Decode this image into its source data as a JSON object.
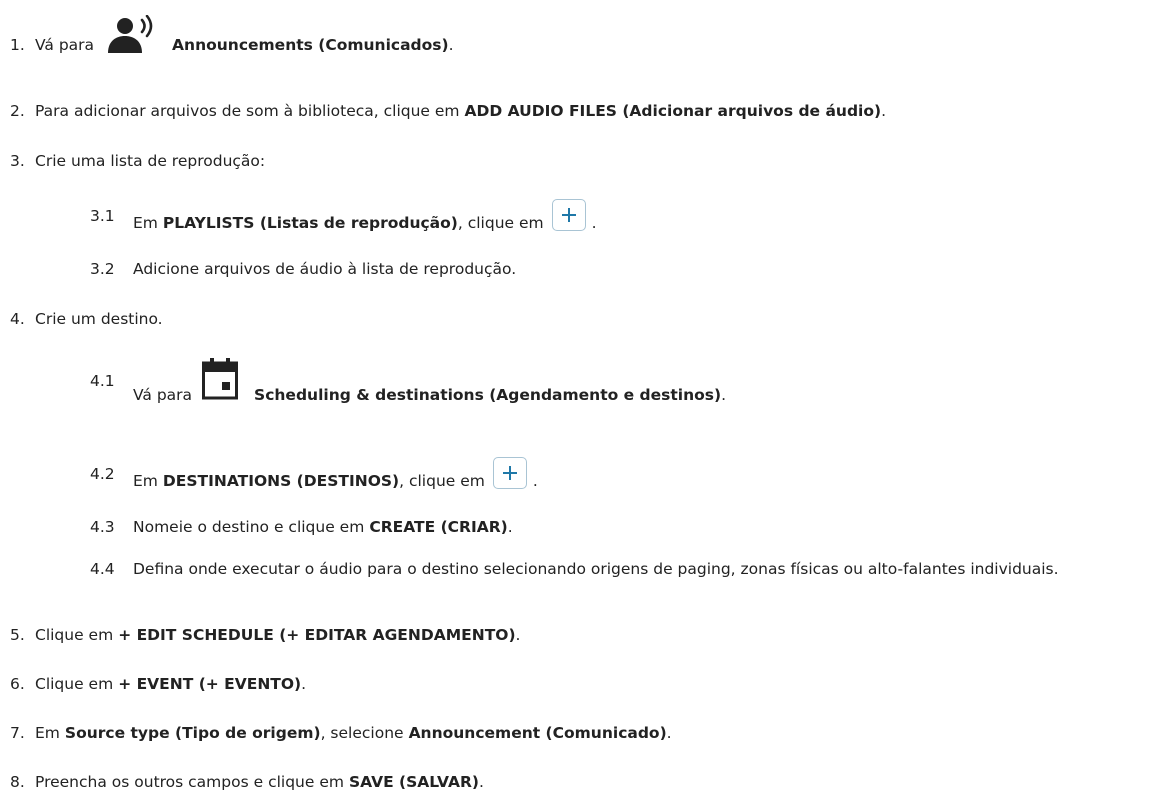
{
  "steps": {
    "s1": {
      "num": "1.",
      "pre": "Vá para",
      "bold": "Announcements (Comunicados)",
      "post": ".",
      "icon": "announcement-speaker-icon"
    },
    "s2": {
      "num": "2.",
      "pre": "Para adicionar arquivos de som à biblioteca, clique em",
      "bold": "ADD AUDIO FILES (Adicionar arquivos de áudio)",
      "post": "."
    },
    "s3": {
      "num": "3.",
      "text": "Crie uma lista de reprodução:"
    },
    "s3_1": {
      "num": "3.1",
      "pre": "Em",
      "bold": "PLAYLISTS (Listas de reprodução)",
      "mid": ", clique em",
      "post": ".",
      "icon": "plus-icon"
    },
    "s3_2": {
      "num": "3.2",
      "text": "Adicione arquivos de áudio à lista de reprodução."
    },
    "s4": {
      "num": "4.",
      "text": "Crie um destino."
    },
    "s4_1": {
      "num": "4.1",
      "pre": "Vá para",
      "bold": "Scheduling & destinations (Agendamento e destinos)",
      "post": ".",
      "icon": "calendar-icon"
    },
    "s4_2": {
      "num": "4.2",
      "pre": "Em",
      "bold": "DESTINATIONS (DESTINOS)",
      "mid": ", clique em",
      "post": ".",
      "icon": "plus-icon"
    },
    "s4_3": {
      "num": "4.3",
      "pre": "Nomeie o destino e clique em",
      "bold": "CREATE (CRIAR)",
      "post": "."
    },
    "s4_4": {
      "num": "4.4",
      "text": "Defina onde executar o áudio para o destino selecionando origens de paging, zonas físicas ou alto-falantes individuais."
    },
    "s5": {
      "num": "5.",
      "pre": "Clique em",
      "bold": "+ EDIT SCHEDULE (+ EDITAR AGENDAMENTO)",
      "post": "."
    },
    "s6": {
      "num": "6.",
      "pre": "Clique em",
      "bold": "+ EVENT (+ EVENTO)",
      "post": "."
    },
    "s7": {
      "num": "7.",
      "pre": "Em",
      "bold": "Source type (Tipo de origem)",
      "mid": ", selecione",
      "bold2": "Announcement (Comunicado)",
      "post": "."
    },
    "s8": {
      "num": "8.",
      "pre": "Preencha os outros campos e clique em",
      "bold": "SAVE (SALVAR)",
      "post": "."
    }
  },
  "colors": {
    "text": "#222222",
    "icon": "#222222",
    "plus_accent": "#1f78a8",
    "plus_border": "#a9c4d4"
  }
}
